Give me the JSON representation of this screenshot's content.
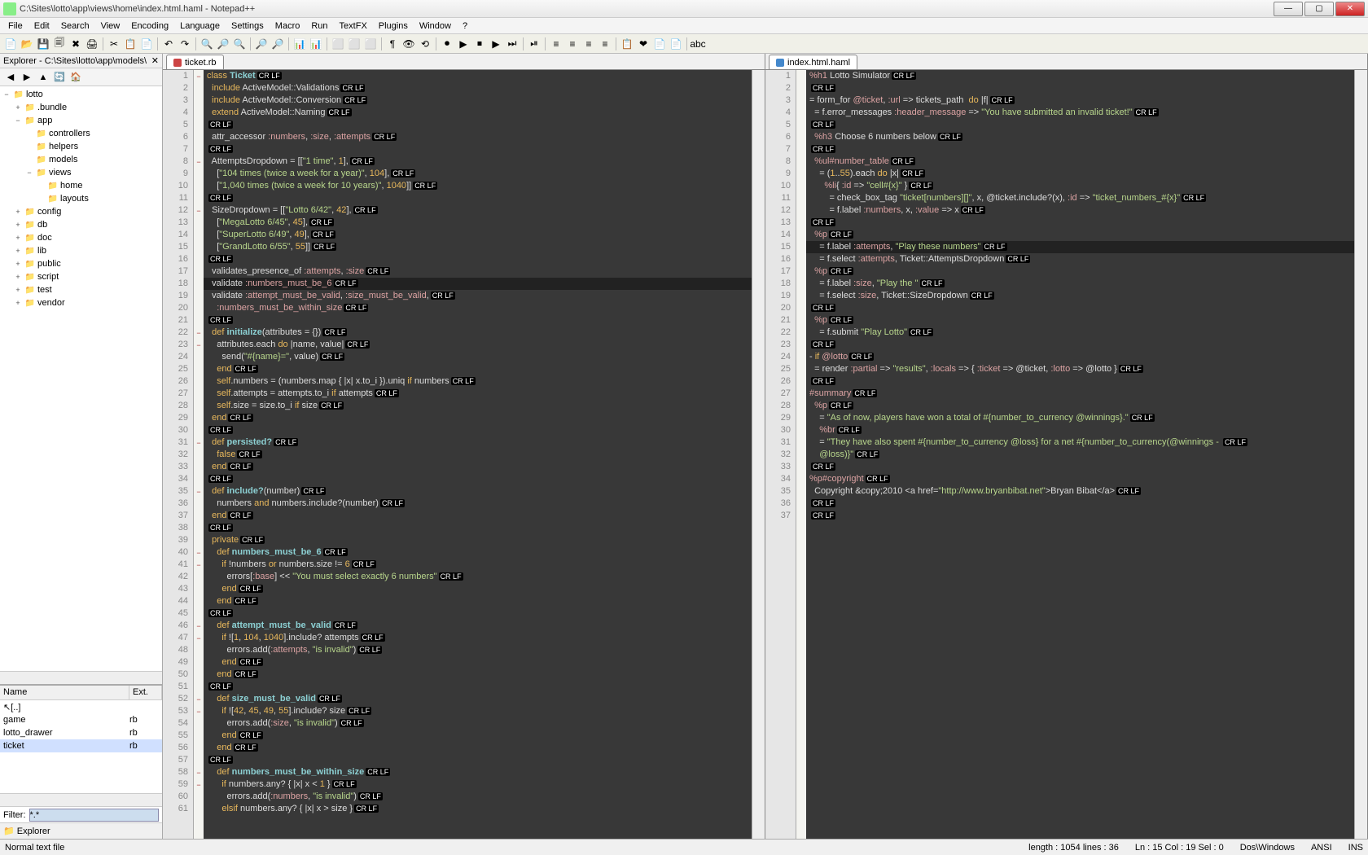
{
  "window": {
    "title": "C:\\Sites\\lotto\\app\\views\\home\\index.html.haml - Notepad++",
    "min": "—",
    "max": "▢",
    "close": "✕"
  },
  "menu": [
    "File",
    "Edit",
    "Search",
    "View",
    "Encoding",
    "Language",
    "Settings",
    "Macro",
    "Run",
    "TextFX",
    "Plugins",
    "Window",
    "?"
  ],
  "toolbar_icons": [
    "📄",
    "📂",
    "💾",
    "🗐",
    "✖",
    "🖨",
    "|",
    "✂",
    "📋",
    "📄",
    "|",
    "↶",
    "↷",
    "|",
    "🔍",
    "🔎",
    "🔍",
    "|",
    "🔎",
    "🔎",
    "|",
    "📊",
    "📊",
    "|",
    "⬜",
    "⬜",
    "⬜",
    "|",
    "¶",
    "👁",
    "⟲",
    "|",
    "⏺",
    "▶",
    "⏹",
    "▶",
    "⏭",
    "|",
    "⏯",
    "|",
    "≡",
    "≡",
    "≡",
    "≡",
    "|",
    "📋",
    "❤",
    "📄",
    "📄",
    "|",
    "abc"
  ],
  "sidebar": {
    "title": "Explorer - C:\\Sites\\lotto\\app\\models\\",
    "nav": [
      "◀",
      "▶",
      "▲",
      "🔄",
      "🏠"
    ],
    "tree": [
      {
        "d": 0,
        "exp": "−",
        "icn": "📁",
        "label": "lotto"
      },
      {
        "d": 1,
        "exp": "+",
        "icn": "📁",
        "label": ".bundle"
      },
      {
        "d": 1,
        "exp": "−",
        "icn": "📁",
        "label": "app"
      },
      {
        "d": 2,
        "exp": "",
        "icn": "📁",
        "label": "controllers"
      },
      {
        "d": 2,
        "exp": "",
        "icn": "📁",
        "label": "helpers"
      },
      {
        "d": 2,
        "exp": "",
        "icn": "📁",
        "label": "models"
      },
      {
        "d": 2,
        "exp": "−",
        "icn": "📁",
        "label": "views"
      },
      {
        "d": 3,
        "exp": "",
        "icn": "📁",
        "label": "home"
      },
      {
        "d": 3,
        "exp": "",
        "icn": "📁",
        "label": "layouts"
      },
      {
        "d": 1,
        "exp": "+",
        "icn": "📁",
        "label": "config"
      },
      {
        "d": 1,
        "exp": "+",
        "icn": "📁",
        "label": "db"
      },
      {
        "d": 1,
        "exp": "+",
        "icn": "📁",
        "label": "doc"
      },
      {
        "d": 1,
        "exp": "+",
        "icn": "📁",
        "label": "lib"
      },
      {
        "d": 1,
        "exp": "+",
        "icn": "📁",
        "label": "public"
      },
      {
        "d": 1,
        "exp": "+",
        "icn": "📁",
        "label": "script"
      },
      {
        "d": 1,
        "exp": "+",
        "icn": "📁",
        "label": "test"
      },
      {
        "d": 1,
        "exp": "+",
        "icn": "📁",
        "label": "vendor"
      }
    ],
    "filelist": {
      "headers": [
        "Name",
        "Ext."
      ],
      "rows": [
        {
          "name": "↖[..]",
          "ext": ""
        },
        {
          "name": "game",
          "ext": "rb"
        },
        {
          "name": "lotto_drawer",
          "ext": "rb"
        },
        {
          "name": "ticket",
          "ext": "rb",
          "sel": true
        }
      ]
    },
    "filter_label": "Filter:",
    "filter_value": "*.*",
    "bottom_tab": "📁 Explorer"
  },
  "editor_left": {
    "tab": "ticket.rb",
    "highlight_line": 18,
    "lines": [
      {
        "n": 1,
        "f": "−",
        "t": "<span class='kw'>class</span> <span class='cls'>Ticket</span>"
      },
      {
        "n": 2,
        "t": "  <span class='kw'>include</span> ActiveModel::Validations"
      },
      {
        "n": 3,
        "t": "  <span class='kw'>include</span> ActiveModel::Conversion"
      },
      {
        "n": 4,
        "t": "  <span class='kw'>extend</span> ActiveModel::Naming"
      },
      {
        "n": 5,
        "t": ""
      },
      {
        "n": 6,
        "t": "  attr_accessor <span class='sym'>:numbers</span>, <span class='sym'>:size</span>, <span class='sym'>:attempts</span>"
      },
      {
        "n": 7,
        "t": ""
      },
      {
        "n": 8,
        "f": "−",
        "t": "  AttemptsDropdown = [[<span class='str'>\"1 time\"</span>, <span class='num'>1</span>],"
      },
      {
        "n": 9,
        "t": "    [<span class='str'>\"104 times (twice a week for a year)\"</span>, <span class='num'>104</span>],"
      },
      {
        "n": 10,
        "t": "    [<span class='str'>\"1,040 times (twice a week for 10 years)\"</span>, <span class='num'>1040</span>]]"
      },
      {
        "n": 11,
        "t": ""
      },
      {
        "n": 12,
        "f": "−",
        "t": "  SizeDropdown = [[<span class='str'>\"Lotto 6/42\"</span>, <span class='num'>42</span>],"
      },
      {
        "n": 13,
        "t": "    [<span class='str'>\"MegaLotto 6/45\"</span>, <span class='num'>45</span>],"
      },
      {
        "n": 14,
        "t": "    [<span class='str'>\"SuperLotto 6/49\"</span>, <span class='num'>49</span>],"
      },
      {
        "n": 15,
        "t": "    [<span class='str'>\"GrandLotto 6/55\"</span>, <span class='num'>55</span>]]"
      },
      {
        "n": 16,
        "t": ""
      },
      {
        "n": 17,
        "t": "  validates_presence_of <span class='sym'>:attempts</span>, <span class='sym'>:size</span>"
      },
      {
        "n": 18,
        "t": "  validate <span class='sym'>:numbers_must_be_6</span>"
      },
      {
        "n": 19,
        "t": "  validate <span class='sym'>:attempt_must_be_valid</span>, <span class='sym'>:size_must_be_valid</span>,"
      },
      {
        "n": 20,
        "t": "    <span class='sym'>:numbers_must_be_within_size</span>"
      },
      {
        "n": 21,
        "t": ""
      },
      {
        "n": 22,
        "f": "−",
        "t": "  <span class='kw'>def</span> <span class='cls'>initialize</span>(attributes = {})"
      },
      {
        "n": 23,
        "f": "−",
        "t": "    attributes.each <span class='kw'>do</span> |name, value|"
      },
      {
        "n": 24,
        "t": "      send(<span class='str'>\"#{name}=\"</span>, value)"
      },
      {
        "n": 25,
        "t": "    <span class='kw'>end</span>"
      },
      {
        "n": 26,
        "t": "    <span class='kw'>self</span>.numbers = (numbers.map { |x| x.to_i }).uniq <span class='kw'>if</span> numbers"
      },
      {
        "n": 27,
        "t": "    <span class='kw'>self</span>.attempts = attempts.to_i <span class='kw'>if</span> attempts"
      },
      {
        "n": 28,
        "t": "    <span class='kw'>self</span>.size = size.to_i <span class='kw'>if</span> size"
      },
      {
        "n": 29,
        "t": "  <span class='kw'>end</span>"
      },
      {
        "n": 30,
        "t": ""
      },
      {
        "n": 31,
        "f": "−",
        "t": "  <span class='kw'>def</span> <span class='cls'>persisted?</span>"
      },
      {
        "n": 32,
        "t": "    <span class='kw'>false</span>"
      },
      {
        "n": 33,
        "t": "  <span class='kw'>end</span>"
      },
      {
        "n": 34,
        "t": ""
      },
      {
        "n": 35,
        "f": "−",
        "t": "  <span class='kw'>def</span> <span class='cls'>include?</span>(number)"
      },
      {
        "n": 36,
        "t": "    numbers <span class='kw'>and</span> numbers.include?(number)"
      },
      {
        "n": 37,
        "t": "  <span class='kw'>end</span>"
      },
      {
        "n": 38,
        "t": ""
      },
      {
        "n": 39,
        "t": "  <span class='kw'>private</span>"
      },
      {
        "n": 40,
        "f": "−",
        "t": "    <span class='kw'>def</span> <span class='cls'>numbers_must_be_6</span>"
      },
      {
        "n": 41,
        "f": "−",
        "t": "      <span class='kw'>if</span> !numbers <span class='kw'>or</span> numbers.size != <span class='num'>6</span>"
      },
      {
        "n": 42,
        "t": "        errors[<span class='sym'>:base</span>] &lt;&lt; <span class='str'>\"You must select exactly 6 numbers\"</span>"
      },
      {
        "n": 43,
        "t": "      <span class='kw'>end</span>"
      },
      {
        "n": 44,
        "t": "    <span class='kw'>end</span>"
      },
      {
        "n": 45,
        "t": ""
      },
      {
        "n": 46,
        "f": "−",
        "t": "    <span class='kw'>def</span> <span class='cls'>attempt_must_be_valid</span>"
      },
      {
        "n": 47,
        "f": "−",
        "t": "      <span class='kw'>if</span> ![<span class='num'>1</span>, <span class='num'>104</span>, <span class='num'>1040</span>].include? attempts"
      },
      {
        "n": 48,
        "t": "        errors.add(<span class='sym'>:attempts</span>, <span class='str'>\"is invalid\"</span>)"
      },
      {
        "n": 49,
        "t": "      <span class='kw'>end</span>"
      },
      {
        "n": 50,
        "t": "    <span class='kw'>end</span>"
      },
      {
        "n": 51,
        "t": ""
      },
      {
        "n": 52,
        "f": "−",
        "t": "    <span class='kw'>def</span> <span class='cls'>size_must_be_valid</span>"
      },
      {
        "n": 53,
        "f": "−",
        "t": "      <span class='kw'>if</span> ![<span class='num'>42</span>, <span class='num'>45</span>, <span class='num'>49</span>, <span class='num'>55</span>].include? size"
      },
      {
        "n": 54,
        "t": "        errors.add(<span class='sym'>:size</span>, <span class='str'>\"is invalid\"</span>)"
      },
      {
        "n": 55,
        "t": "      <span class='kw'>end</span>"
      },
      {
        "n": 56,
        "t": "    <span class='kw'>end</span>"
      },
      {
        "n": 57,
        "t": ""
      },
      {
        "n": 58,
        "f": "−",
        "t": "    <span class='kw'>def</span> <span class='cls'>numbers_must_be_within_size</span>"
      },
      {
        "n": 59,
        "f": "−",
        "t": "      <span class='kw'>if</span> numbers.any? { |x| x &lt; <span class='num'>1</span> }"
      },
      {
        "n": 60,
        "t": "        errors.add(<span class='sym'>:numbers</span>, <span class='str'>\"is invalid\"</span>)"
      },
      {
        "n": 61,
        "t": "      <span class='kw'>elsif</span> numbers.any? { |x| x &gt; size }"
      }
    ]
  },
  "editor_right": {
    "tab": "index.html.haml",
    "highlight_line": 15,
    "lines": [
      {
        "n": 1,
        "t": "<span class='sym'>%h1</span> Lotto Simulator"
      },
      {
        "n": 2,
        "t": ""
      },
      {
        "n": 3,
        "t": "= form_for <span class='sym'>@ticket</span>, <span class='sym'>:url</span> =&gt; tickets_path  <span class='kw'>do</span> |f|"
      },
      {
        "n": 4,
        "t": "  = f.error_messages <span class='sym'>:header_message</span> =&gt; <span class='str'>\"You have submitted an invalid ticket!\"</span>"
      },
      {
        "n": 5,
        "t": ""
      },
      {
        "n": 6,
        "t": "  <span class='sym'>%h3</span> Choose 6 numbers below"
      },
      {
        "n": 7,
        "t": ""
      },
      {
        "n": 8,
        "t": "  <span class='sym'>%ul#number_table</span>"
      },
      {
        "n": 9,
        "t": "    = (<span class='num'>1</span>..<span class='num'>55</span>).each <span class='kw'>do</span> |x|"
      },
      {
        "n": 10,
        "t": "      <span class='sym'>%li</span>{ <span class='sym'>:id</span> =&gt; <span class='str'>\"cell#{x}\"</span> }"
      },
      {
        "n": 11,
        "t": "        = check_box_tag <span class='str'>\"ticket[numbers][]\"</span>, x, @ticket.include?(x), <span class='sym'>:id</span> =&gt; <span class='str'>\"ticket_numbers_#{x}\"</span>"
      },
      {
        "n": 12,
        "t": "        = f.label <span class='sym'>:numbers</span>, x, <span class='sym'>:value</span> =&gt; x"
      },
      {
        "n": 13,
        "t": ""
      },
      {
        "n": 14,
        "t": "  <span class='sym'>%p</span>"
      },
      {
        "n": 15,
        "t": "    = f.label <span class='sym'>:attempts</span>, <span class='str'>\"Play these numbers\"</span>"
      },
      {
        "n": 16,
        "t": "    = f.select <span class='sym'>:attempts</span>, Ticket::AttemptsDropdown"
      },
      {
        "n": 17,
        "t": "  <span class='sym'>%p</span>"
      },
      {
        "n": 18,
        "t": "    = f.label <span class='sym'>:size</span>, <span class='str'>\"Play the \"</span>"
      },
      {
        "n": 19,
        "t": "    = f.select <span class='sym'>:size</span>, Ticket::SizeDropdown"
      },
      {
        "n": 20,
        "t": ""
      },
      {
        "n": 21,
        "t": "  <span class='sym'>%p</span>"
      },
      {
        "n": 22,
        "t": "    = f.submit <span class='str'>\"Play Lotto\"</span>"
      },
      {
        "n": 23,
        "t": ""
      },
      {
        "n": 24,
        "t": "- <span class='kw'>if</span> <span class='sym'>@lotto</span>"
      },
      {
        "n": 25,
        "t": "  = render <span class='sym'>:partial</span> =&gt; <span class='str'>\"results\"</span>, <span class='sym'>:locals</span> =&gt; { <span class='sym'>:ticket</span> =&gt; @ticket, <span class='sym'>:lotto</span> =&gt; @lotto }"
      },
      {
        "n": 26,
        "t": ""
      },
      {
        "n": 27,
        "t": "<span class='sym'>#summary</span>"
      },
      {
        "n": 28,
        "t": "  <span class='sym'>%p</span>"
      },
      {
        "n": 29,
        "t": "    = <span class='str'>\"As of now, players have won a total of #{number_to_currency @winnings}.\"</span>"
      },
      {
        "n": 30,
        "t": "    <span class='sym'>%br</span>"
      },
      {
        "n": 31,
        "t": "    = <span class='str'>\"They have also spent #{number_to_currency @loss} for a net #{number_to_currency(@winnings - "
      },
      {
        "n": 32,
        "t": "<span class='str'>    @loss)}\"</span>"
      },
      {
        "n": 33,
        "t": ""
      },
      {
        "n": 34,
        "t": "<span class='sym'>%p#copyright</span>"
      },
      {
        "n": 35,
        "t": "  Copyright &amp;copy;2010 &lt;a href=<span class='str'>\"http://www.bryanbibat.net\"</span>&gt;Bryan Bibat&lt;/a&gt;"
      },
      {
        "n": 36,
        "t": ""
      },
      {
        "n": 37,
        "t": ""
      }
    ]
  },
  "status": {
    "left": "Normal text file",
    "length": "length : 1054    lines : 36",
    "pos": "Ln : 15    Col : 19    Sel : 0",
    "eol": "Dos\\Windows",
    "enc": "ANSI",
    "ins": "INS"
  }
}
